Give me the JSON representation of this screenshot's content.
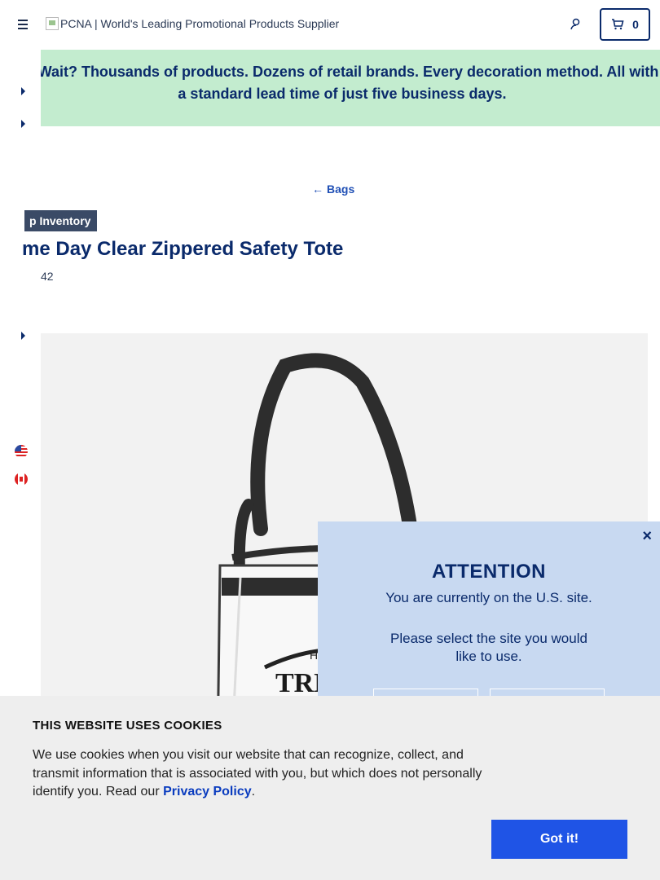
{
  "header": {
    "logo_alt": "PCNA | World's Leading Promotional Products Supplier",
    "cart_count": "0"
  },
  "banner": {
    "text": "y Wait? Thousands of products. Dozens of retail brands. Every decoration method. All with a standard lead time of just five business days."
  },
  "breadcrumb": {
    "label": "Bags"
  },
  "product": {
    "badge": "p Inventory",
    "title": "me Day Clear Zippered Safety Tote",
    "sku": "42"
  },
  "attention": {
    "close": "×",
    "heading": "ATTENTION",
    "message": "You are currently on the U.S. site.",
    "prompt": "Please select the site you would like to use."
  },
  "cookie": {
    "heading": "THIS WEBSITE USES COOKIES",
    "text": "We use cookies when you visit our website that can recognize, collect, and transmit information that is associated with you, but which does not personally identify you. Read our ",
    "link": "Privacy Policy",
    "period": ".",
    "button": "Got it!"
  },
  "colors": {
    "navy": "#0a2a6b",
    "banner_bg": "#c3eccf",
    "dialog_bg": "#c8d9f1",
    "cookie_button": "#1f54e6"
  }
}
